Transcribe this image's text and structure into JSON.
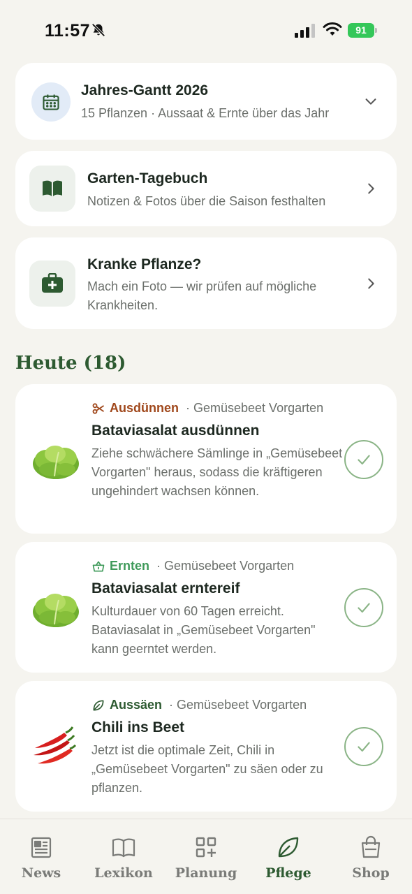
{
  "status_bar": {
    "time": "11:57",
    "battery": "91"
  },
  "cards": {
    "gantt": {
      "title": "Jahres-Gantt 2026",
      "subtitle": "15 Pflanzen · Aussaat & Ernte über das Jahr"
    },
    "diary": {
      "title": "Garten-Tagebuch",
      "subtitle": "Notizen & Fotos über die Saison festhalten"
    },
    "sick": {
      "title": "Kranke Pflanze?",
      "subtitle": "Mach ein Foto — wir prüfen auf mögliche Krankheiten."
    }
  },
  "today": {
    "heading": "Heute (18)",
    "tasks": [
      {
        "type_label": "Ausdünnen",
        "type_color": "#a0481c",
        "location": "· Gemüsebeet Vorgarten",
        "title": "Bataviasalat ausdünnen",
        "description": "Ziehe schwächere Sämlinge in „Gemüsebeet Vorgarten\" heraus, sodass die kräftigeren ungehindert wachsen können.",
        "icon": "scissors-icon",
        "plant": "lettuce"
      },
      {
        "type_label": "Ernten",
        "type_color": "#3f9a5a",
        "location": "· Gemüsebeet Vorgarten",
        "title": "Bataviasalat erntereif",
        "description": "Kulturdauer von 60 Tagen erreicht. Bataviasalat in „Gemüsebeet Vorgarten\" kann geerntet werden.",
        "icon": "basket-icon",
        "plant": "lettuce"
      },
      {
        "type_label": "Aussäen",
        "type_color": "#2d5a31",
        "location": "· Gemüsebeet Vorgarten",
        "title": "Chili ins Beet",
        "description": "Jetzt ist die optimale Zeit, Chili in „Gemüsebeet Vorgarten\" zu säen oder zu pflanzen.",
        "icon": "leaf-icon",
        "plant": "chili"
      }
    ]
  },
  "tabs": [
    {
      "label": "News",
      "icon": "newspaper-icon"
    },
    {
      "label": "Lexikon",
      "icon": "book-icon"
    },
    {
      "label": "Planung",
      "icon": "qr-plus-icon"
    },
    {
      "label": "Pflege",
      "icon": "leaf-icon",
      "active": true
    },
    {
      "label": "Shop",
      "icon": "shopping-bag-icon"
    }
  ],
  "colors": {
    "accent": "#2d5a31",
    "background": "#f5f4ef",
    "check": "#8ab486"
  }
}
